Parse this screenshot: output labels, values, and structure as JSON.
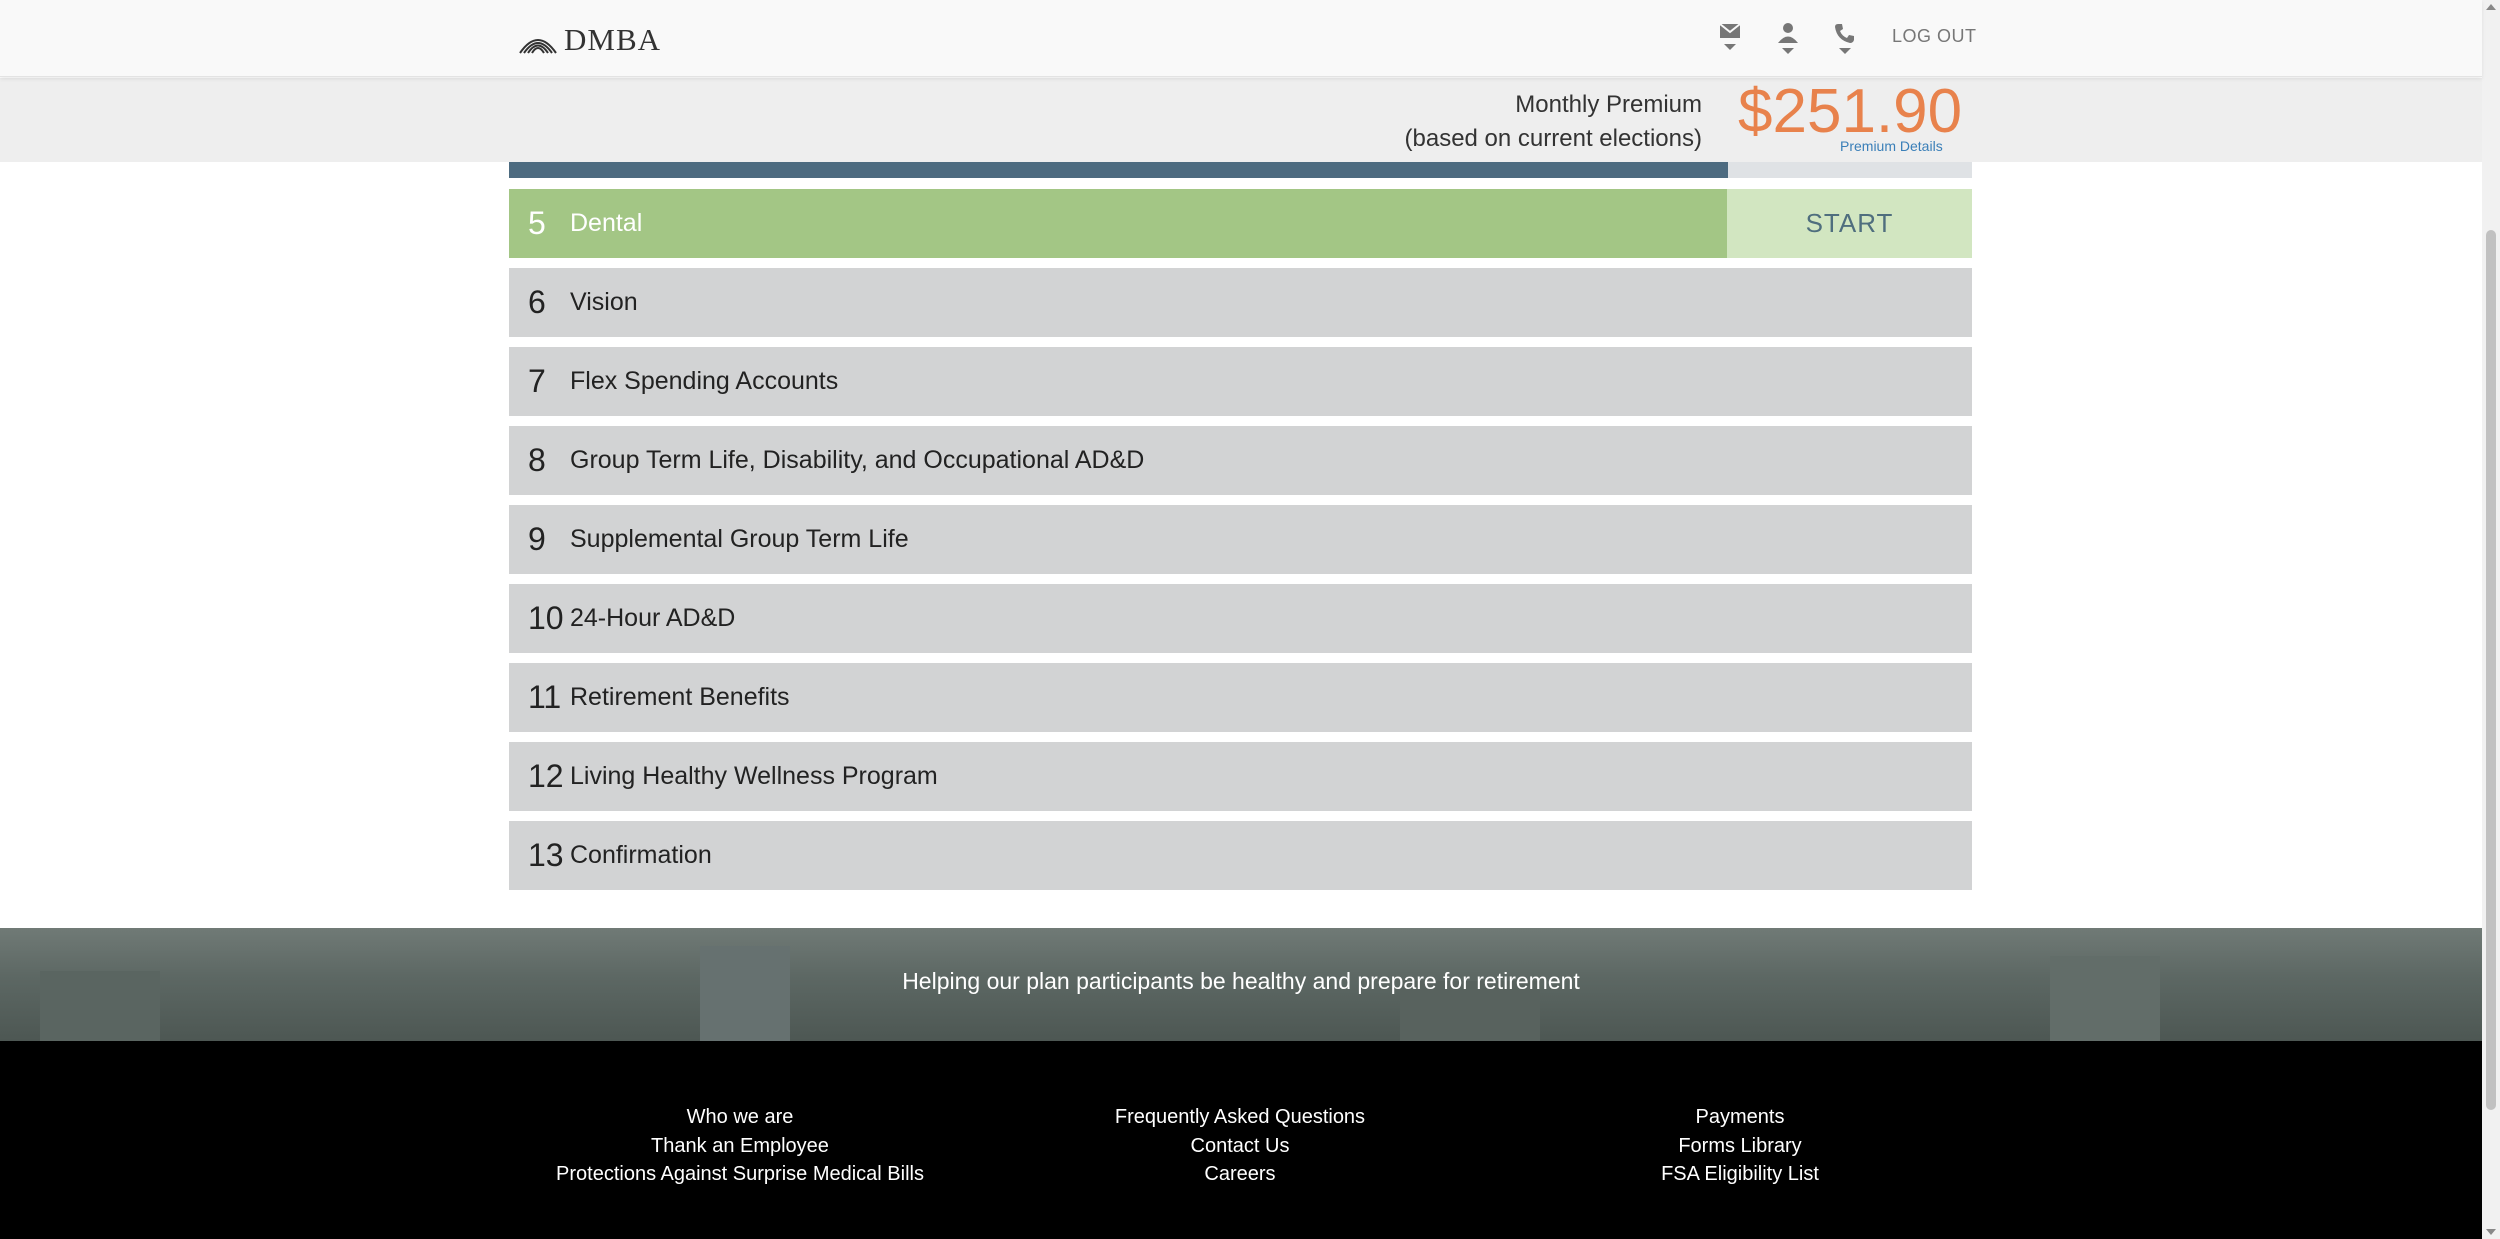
{
  "header": {
    "logo_text": "DMBA",
    "icons": [
      "mail-icon",
      "user-icon",
      "phone-icon"
    ],
    "logout_label": "LOG OUT"
  },
  "premium": {
    "label_line1": "Monthly Premium",
    "label_line2": "(based on current elections)",
    "amount": "$251.90",
    "details_link": "Premium Details",
    "amount_color": "#e8824c"
  },
  "progress": {
    "fraction_complete": 0.833
  },
  "steps": [
    {
      "number": "5",
      "name": "Dental",
      "active": true,
      "action": "START"
    },
    {
      "number": "6",
      "name": "Vision"
    },
    {
      "number": "7",
      "name": "Flex Spending Accounts"
    },
    {
      "number": "8",
      "name": "Group Term Life, Disability, and Occupational AD&D"
    },
    {
      "number": "9",
      "name": "Supplemental Group Term Life"
    },
    {
      "number": "10",
      "name": "24-Hour AD&D"
    },
    {
      "number": "11",
      "name": "Retirement Benefits"
    },
    {
      "number": "12",
      "name": "Living Healthy Wellness Program"
    },
    {
      "number": "13",
      "name": "Confirmation"
    }
  ],
  "colors": {
    "active_step": "#a3c685",
    "start_button": "#d2e6c1",
    "inactive_step": "#d2d3d4",
    "progress": "#4d6b80"
  },
  "banner": {
    "text": "Helping our plan participants be healthy and prepare for retirement"
  },
  "footer": {
    "columns": [
      [
        "Who we are",
        "Thank an Employee",
        "Protections Against Surprise Medical Bills"
      ],
      [
        "Frequently Asked Questions",
        "Contact Us",
        "Careers"
      ],
      [
        "Payments",
        "Forms Library",
        "FSA Eligibility List"
      ]
    ]
  }
}
